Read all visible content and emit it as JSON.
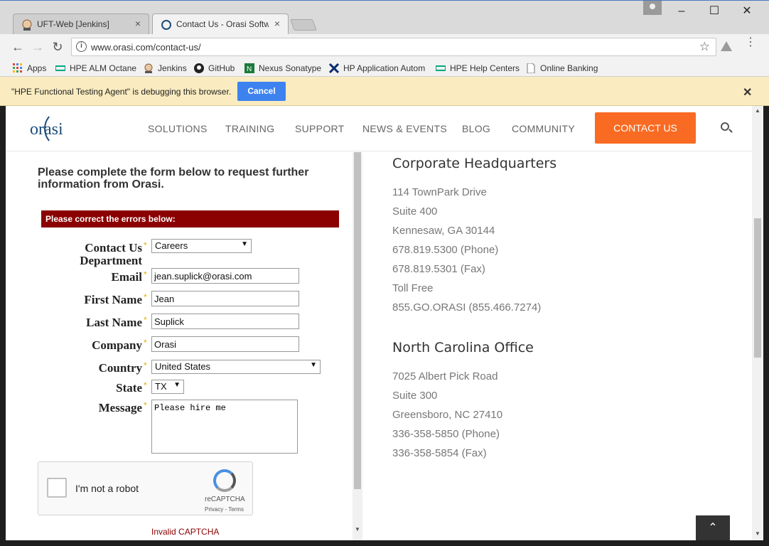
{
  "tabs": [
    {
      "title": "UFT-Web [Jenkins]",
      "close": "×"
    },
    {
      "title": "Contact Us - Orasi Softw",
      "close": "×"
    }
  ],
  "window_controls": {
    "minimize": "–",
    "maximize": "☐",
    "close": "✕"
  },
  "toolbar": {
    "back": "←",
    "forward": "→",
    "reload": "↻",
    "url": "www.orasi.com/contact-us/",
    "info": "i",
    "star": "☆",
    "menu": "⋮"
  },
  "bookmarks": [
    {
      "label": "Apps",
      "icon": "apps-grid-icon",
      "color": "#e94235"
    },
    {
      "label": "HPE ALM Octane",
      "icon": "hpe-icon",
      "color": "#01a982"
    },
    {
      "label": "Jenkins",
      "icon": "jenkins-icon",
      "color": "#d33833"
    },
    {
      "label": "GitHub",
      "icon": "github-icon",
      "color": "#222222"
    },
    {
      "label": "Nexus Sonatype",
      "icon": "nexus-icon",
      "color": "#1b7a3a"
    },
    {
      "label": "HP Application Autom",
      "icon": "hp-tools-icon",
      "color": "#0a2d6e"
    },
    {
      "label": "HPE Help Centers",
      "icon": "hpe-icon",
      "color": "#01a982"
    },
    {
      "label": "Online Banking",
      "icon": "page-icon",
      "color": "#777777"
    }
  ],
  "infobar": {
    "message": "\"HPE Functional Testing Agent\" is debugging this browser.",
    "cancel": "Cancel",
    "close": "✕"
  },
  "site": {
    "logo": "orasi",
    "nav": [
      "SOLUTIONS",
      "TRAINING",
      "SUPPORT",
      "NEWS & EVENTS",
      "BLOG",
      "COMMUNITY"
    ],
    "contact_button": "CONTACT US",
    "accent_color": "#f96a22"
  },
  "form": {
    "intro": "Please complete the form below to request further information from Orasi.",
    "error_banner": "Please correct the errors below:",
    "required_mark": "*",
    "fields": {
      "department": {
        "label": "Contact Us Department",
        "value": "Careers"
      },
      "email": {
        "label": "Email",
        "value": "jean.suplick@orasi.com"
      },
      "first_name": {
        "label": "First Name",
        "value": "Jean"
      },
      "last_name": {
        "label": "Last Name",
        "value": "Suplick"
      },
      "company": {
        "label": "Company",
        "value": "Orasi"
      },
      "country": {
        "label": "Country",
        "value": "United States"
      },
      "state": {
        "label": "State",
        "value": "TX"
      },
      "message": {
        "label": "Message",
        "value": "Please hire me"
      }
    },
    "dropdown_arrow": "▼",
    "captcha": {
      "label": "I'm not a robot",
      "brand": "reCAPTCHA",
      "terms": "Privacy - Terms"
    },
    "captcha_error": "Invalid CAPTCHA"
  },
  "offices": [
    {
      "title": "Corporate Headquarters",
      "lines": [
        "114 TownPark Drive",
        "Suite 400",
        "Kennesaw, GA 30144",
        "678.819.5300 (Phone)",
        "678.819.5301 (Fax)",
        "Toll Free",
        "855.GO.ORASI (855.466.7274)"
      ]
    },
    {
      "title": "North Carolina Office",
      "lines": [
        "7025 Albert Pick Road",
        "Suite 300",
        "Greensboro, NC 27410",
        "336-358-5850 (Phone)",
        "336-358-5854 (Fax)"
      ]
    }
  ],
  "back_to_top": "⌃"
}
